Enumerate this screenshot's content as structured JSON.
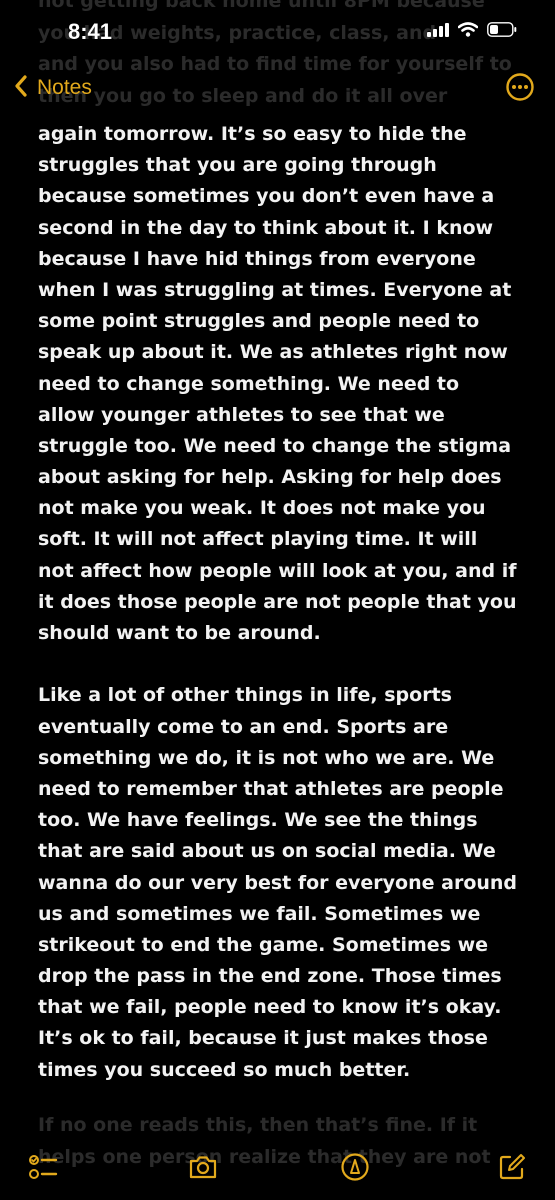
{
  "status_bar": {
    "time": "8:41",
    "icons": [
      "signal-icon",
      "wifi-icon",
      "battery-icon"
    ]
  },
  "nav": {
    "back_label": "Notes",
    "back_icon": "chevron-left-icon",
    "more_icon": "ellipsis-circle-icon",
    "accent": "#e2a91c"
  },
  "faded_top": [
    "not getting back home until 8PM because",
    "you had weights, practice, class, and",
    "and you also had to find time for yourself to",
    "then you go to sleep and do it all over"
  ],
  "note_lines": [
    "again tomorrow. It’s so easy to hide the",
    "struggles that you are going through",
    "because sometimes you don’t even have a",
    "second in the day to think about it. I know",
    "because I have hid things from everyone",
    "when I was struggling at times. Everyone at",
    "some point struggles and people need to",
    "speak up about it. We as athletes right now",
    "need to change something. We need to",
    "allow younger athletes to see that we",
    "struggle too. We need to change the stigma",
    "about asking for help. Asking for help does",
    "not make you weak. It does not make you",
    "soft. It will not affect playing time. It will",
    "not affect how people will look at you, and if",
    "it does those people are not people that you",
    "should want to be around.",
    "",
    "Like a lot of other things in life, sports",
    "eventually come to an end. Sports are",
    "something we do, it is not who we are. We",
    "need to remember that athletes are people",
    "too. We have feelings. We see the things",
    "that are said about us on social media. We",
    "wanna do our very best for everyone around",
    "us and sometimes we fail. Sometimes we",
    "strikeout to end the game. Sometimes we",
    "drop the pass in the end zone. Those times",
    "that we fail, people need to know it’s okay.",
    "It’s ok to fail, because it just makes those",
    "times you succeed so much better."
  ],
  "faded_bottom": [
    "If no one reads this, then that’s fine. If it",
    "helps one person realize that they are not"
  ],
  "toolbar": {
    "icons": [
      "checklist-icon",
      "camera-icon",
      "markup-pen-icon",
      "compose-icon"
    ],
    "accent": "#e2a91c"
  }
}
